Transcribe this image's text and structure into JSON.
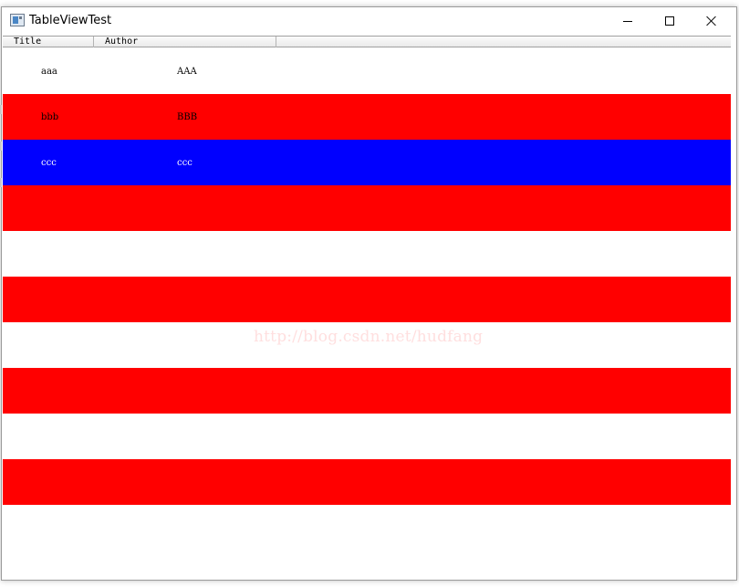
{
  "window": {
    "title": "TableViewTest",
    "icon": "app-window-icon",
    "controls": [
      "minimize-icon",
      "maximize-icon",
      "close-icon"
    ]
  },
  "table": {
    "headers": [
      "Title",
      "Author"
    ],
    "rows": [
      {
        "title": "aaa",
        "author": "AAA",
        "background": "#ffffff",
        "text_color": "#000000"
      },
      {
        "title": "bbb",
        "author": "BBB",
        "background": "#ff0000",
        "text_color": "#000000"
      },
      {
        "title": "ccc",
        "author": "ccc",
        "background": "#0000ff",
        "text_color": "#ffffff"
      },
      {
        "title": "",
        "author": "",
        "background": "#ff0000",
        "text_color": "#000000"
      },
      {
        "title": "",
        "author": "",
        "background": "#ffffff",
        "text_color": "#000000"
      },
      {
        "title": "",
        "author": "",
        "background": "#ff0000",
        "text_color": "#000000"
      },
      {
        "title": "",
        "author": "",
        "background": "#ffffff",
        "text_color": "#000000"
      },
      {
        "title": "",
        "author": "",
        "background": "#ff0000",
        "text_color": "#000000"
      },
      {
        "title": "",
        "author": "",
        "background": "#ffffff",
        "text_color": "#000000"
      },
      {
        "title": "",
        "author": "",
        "background": "#ff0000",
        "text_color": "#000000"
      }
    ]
  },
  "watermark": "http://blog.csdn.net/hudfang"
}
